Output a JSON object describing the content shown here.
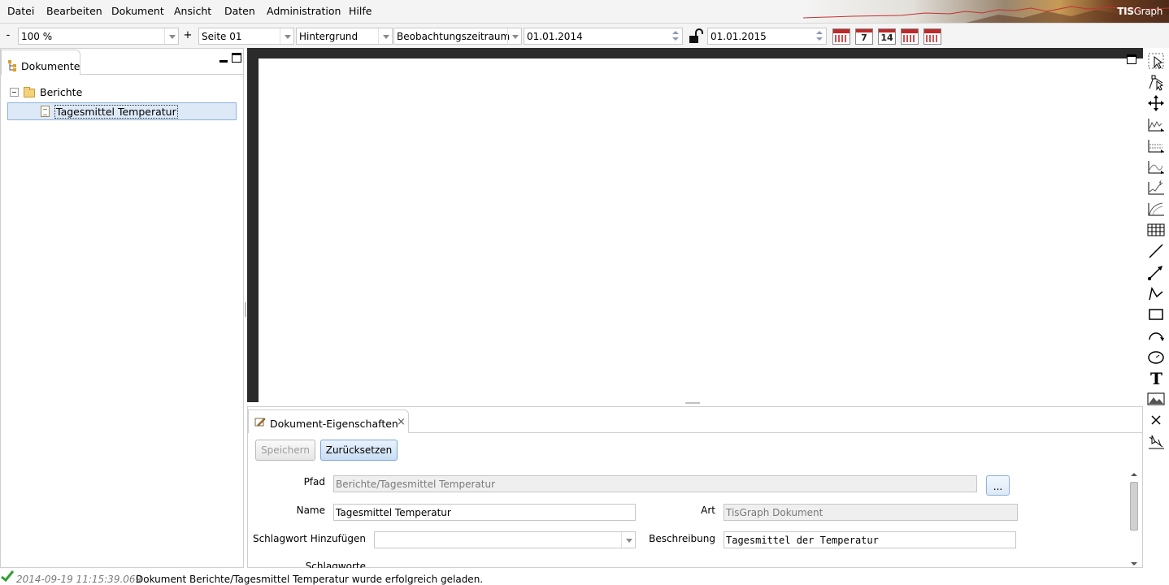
{
  "menu": [
    "Datei",
    "Bearbeiten",
    "Dokument",
    "Ansicht",
    "Daten",
    "Administration",
    "Hilfe"
  ],
  "brand": {
    "logo_bold": "TIS",
    "logo_light": "Graph"
  },
  "toolbar": {
    "zoom_minus": "-",
    "zoom_value": "100 %",
    "zoom_plus": "+",
    "page": "Seite 01",
    "layer": "Hintergrund",
    "period": "Beobachtungszeitraum",
    "date_from": "01.01.2014",
    "date_to": "01.01.2015",
    "calendar_buttons": [
      "",
      "7",
      "14",
      "",
      ""
    ]
  },
  "left_panel": {
    "tab_label": "Dokumente",
    "tree": {
      "folder": "Berichte",
      "document": "Tagesmittel Temperatur"
    }
  },
  "properties": {
    "tab_label": "Dokument-Eigenschaften",
    "tab_close": "×",
    "save_label": "Speichern",
    "reset_label": "Zurücksetzen",
    "path_label": "Pfad",
    "path_value": "Berichte/Tagesmittel Temperatur",
    "browse_label": "...",
    "name_label": "Name",
    "name_value": "Tagesmittel Temperatur",
    "type_label": "Art",
    "type_value": "TisGraph Dokument",
    "keyword_add_label": "Schlagwort Hinzufügen",
    "keyword_add_value": "",
    "description_label": "Beschreibung",
    "description_value": "Tagesmittel der Temperatur",
    "keywords_label": "Schlagworte"
  },
  "status": {
    "timestamp": "2014-09-19 11:15:39.069",
    "message": "Dokument Berichte/Tagesmittel Temperatur wurde erfolgreich geladen."
  },
  "colors": {
    "accent_blue": "#3b6fb6",
    "calendar_red": "#c0282a",
    "success_green": "#2e9e2e",
    "editor_frame": "#2b2b2b"
  },
  "tool_icons": [
    "select-arrow-icon",
    "node-edit-icon",
    "move-cross-icon",
    "chart-line-icon",
    "chart-bar-icon",
    "chart-area-icon",
    "chart-trend-icon",
    "chart-curve-icon",
    "table-icon",
    "line-icon",
    "arrow-line-icon",
    "polyline-icon",
    "rectangle-icon",
    "arc-icon",
    "ellipse-icon",
    "text-icon",
    "image-icon",
    "delete-cross-icon",
    "measure-icon"
  ]
}
